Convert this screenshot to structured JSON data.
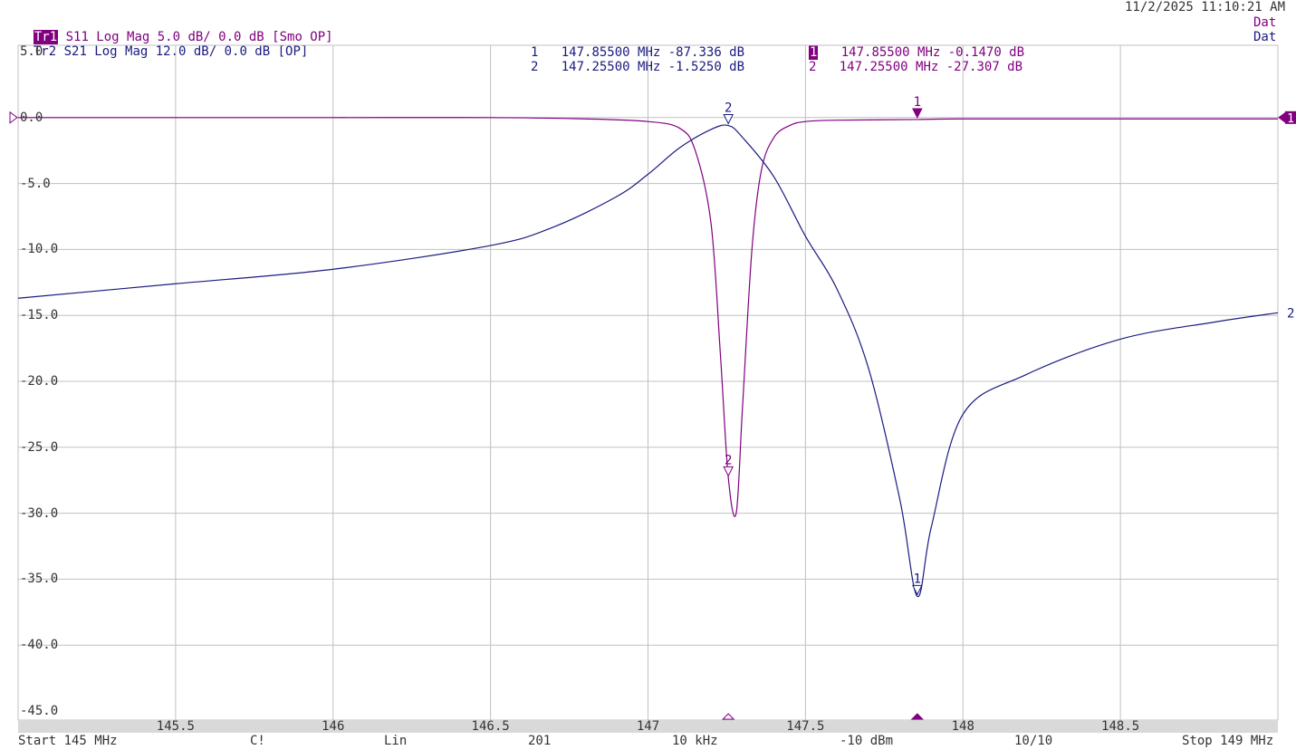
{
  "header": {
    "datetime": "11/2/2025 11:10:21 AM",
    "trace1": {
      "badge": "Tr1",
      "text": " S11 Log Mag 5.0 dB/ 0.0 dB [Smo OP]",
      "right": "Dat"
    },
    "trace2": {
      "badge": "Tr2",
      "text": " S21 Log Mag 12.0 dB/ 0.0 dB [OP]",
      "right": "Dat"
    }
  },
  "marker_table": {
    "trace2": [
      {
        "num": "1",
        "freq": "147.85500 MHz",
        "value": "-87.336 dB"
      },
      {
        "num": "2",
        "freq": "147.25500 MHz",
        "value": "-1.5250 dB"
      }
    ],
    "trace1": [
      {
        "num": "1",
        "freq": "147.85500 MHz",
        "value": "-0.1470 dB"
      },
      {
        "num": "2",
        "freq": "147.25500 MHz",
        "value": "-27.307 dB"
      }
    ]
  },
  "y_ticks": [
    "5.0",
    "0.0",
    "-5.0",
    "-10.0",
    "-15.0",
    "-20.0",
    "-25.0",
    "-30.0",
    "-35.0",
    "-40.0",
    "-45.0"
  ],
  "x_ticks": [
    "145.5",
    "146",
    "146.5",
    "147",
    "147.5",
    "148",
    "148.5"
  ],
  "status_bar": {
    "start": "Start 145 MHz",
    "cal": "C!",
    "sweep": "Lin",
    "points": "201",
    "ifbw": "10 kHz",
    "power": "-10 dBm",
    "avg": "10/10",
    "stop": "Stop 149 MHz"
  },
  "colors": {
    "trace1": "#800080",
    "trace2": "#1a1a80",
    "grid": "#c0c0c0"
  },
  "chart_data": {
    "type": "line",
    "xlabel": "",
    "ylabel": "",
    "xlim": [
      145,
      149
    ],
    "ylim": [
      -45,
      5
    ],
    "grid": true,
    "series": [
      {
        "name": "S11",
        "x": [
          145.0,
          145.5,
          146.0,
          146.5,
          146.8,
          147.0,
          147.1,
          147.15,
          147.2,
          147.23,
          147.255,
          147.28,
          147.3,
          147.33,
          147.36,
          147.4,
          147.45,
          147.5,
          147.6,
          147.855,
          148.0,
          148.5,
          149.0
        ],
        "y": [
          0.0,
          0.0,
          0.0,
          0.0,
          -0.1,
          -0.3,
          -0.8,
          -2.5,
          -8.0,
          -18.0,
          -27.3,
          -30.0,
          -22.0,
          -10.0,
          -4.0,
          -1.5,
          -0.6,
          -0.3,
          -0.2,
          -0.147,
          -0.1,
          -0.1,
          -0.1
        ]
      },
      {
        "name": "S21",
        "x": [
          145.0,
          145.5,
          146.0,
          146.5,
          146.7,
          146.9,
          147.0,
          147.1,
          147.2,
          147.255,
          147.3,
          147.4,
          147.5,
          147.6,
          147.7,
          147.8,
          147.855,
          147.9,
          148.0,
          148.2,
          148.5,
          148.8,
          149.0
        ],
        "y": [
          -13.7,
          -12.6,
          -11.5,
          -9.7,
          -8.3,
          -6.0,
          -4.3,
          -2.3,
          -0.9,
          -0.6,
          -1.5,
          -4.5,
          -9.0,
          -13.0,
          -19.0,
          -29.0,
          -36.3,
          -31.0,
          -22.5,
          -19.5,
          -16.8,
          -15.5,
          -14.8
        ]
      }
    ],
    "markers": [
      {
        "trace": "S11",
        "label": "1",
        "x": 147.855,
        "y": -0.147
      },
      {
        "trace": "S11",
        "label": "2",
        "x": 147.255,
        "y": -27.307
      },
      {
        "trace": "S21",
        "label": "1",
        "x": 147.855,
        "y": -36.3
      },
      {
        "trace": "S21",
        "label": "2",
        "x": 147.255,
        "y": -0.6
      }
    ],
    "end_labels": [
      {
        "trace": "S11",
        "label": "1"
      },
      {
        "trace": "S21",
        "label": "2"
      }
    ]
  }
}
